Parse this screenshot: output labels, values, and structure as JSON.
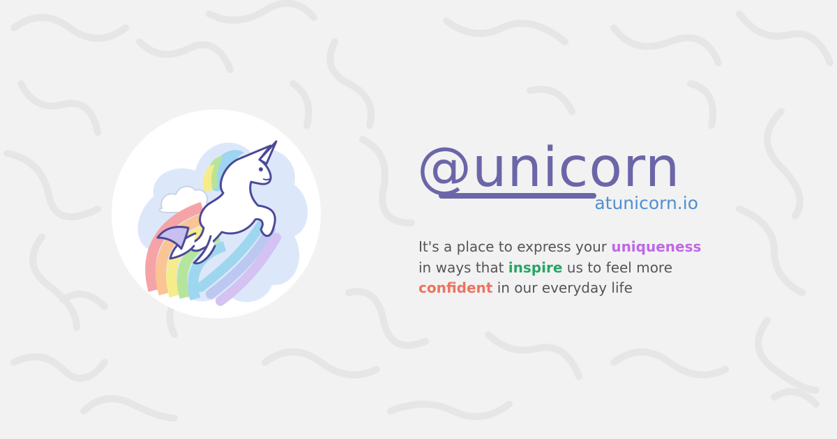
{
  "brand": {
    "name": "@unicorn",
    "domain": "atunicorn.io"
  },
  "tagline": {
    "line1_prefix": "It's a place to express your ",
    "line1_highlight": "uniqueness",
    "line2_prefix": "in ways that ",
    "line2_highlight": "inspire",
    "line2_suffix": " us to feel more",
    "line3_highlight": "confident",
    "line3_suffix": " in our everyday life"
  },
  "colors": {
    "background": "#f2f2f2",
    "brand": "#6b66a8",
    "domain": "#4f8fcf",
    "uniqueness": "#c067e6",
    "inspire": "#2aa565",
    "confident": "#ec7460",
    "body_text": "#555555"
  },
  "icons": {
    "logo": "unicorn-rainbow-icon"
  }
}
